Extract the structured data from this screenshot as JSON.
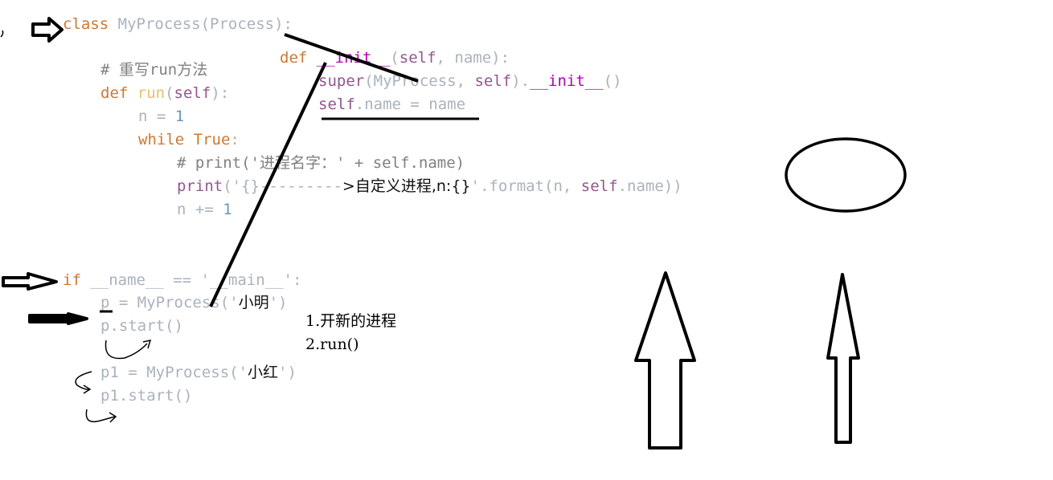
{
  "code": {
    "l1": {
      "kw": "class",
      "name": " MyProcess",
      "paren": "(Process):"
    },
    "l2": {
      "kw": "def",
      "sp": " ",
      "fn": "__init__",
      "rest1": "(",
      "self": "self",
      "rest2": ", name):"
    },
    "l3": {
      "fn": "super",
      "rest1": "(MyProcess, ",
      "self": "self",
      "rest2": ").",
      "dunder": "__init__",
      "rest3": "()"
    },
    "l4": {
      "self": "self",
      "rest": ".name = name"
    },
    "l5": {
      "comment": "# 重写run方法"
    },
    "l6": {
      "kw": "def",
      "fn": " run",
      "rest1": "(",
      "self": "self",
      "rest2": "):"
    },
    "l7": {
      "var": "n = ",
      "num": "1"
    },
    "l8": {
      "kw": "while",
      "kw2": " True",
      "rest": ":"
    },
    "l9": {
      "comment": "# print('进程名字：' + self.name)"
    },
    "l10": {
      "fn": "print",
      "rest1": "('{}---------",
      "cn": ">自定义进程,n:{}",
      "rest2": "'.format(n, ",
      "self": "self",
      "rest3": ".name))"
    },
    "l11": {
      "var": "n += ",
      "num": "1"
    },
    "l12": {
      "kw": "if",
      "rest": " __name__ == '__main__':"
    },
    "l13": {
      "rest1": "p = MyProcess('",
      "cn": "小明",
      "rest2": "')"
    },
    "l14": {
      "rest": "p.start()"
    },
    "l15": {
      "rest1": "p1 = MyProcess('",
      "cn": "小红",
      "rest2": "')"
    },
    "l16": {
      "rest": "p1.start()"
    }
  },
  "notes": {
    "step1": "1.开新的进程",
    "step2": "2.run()"
  }
}
